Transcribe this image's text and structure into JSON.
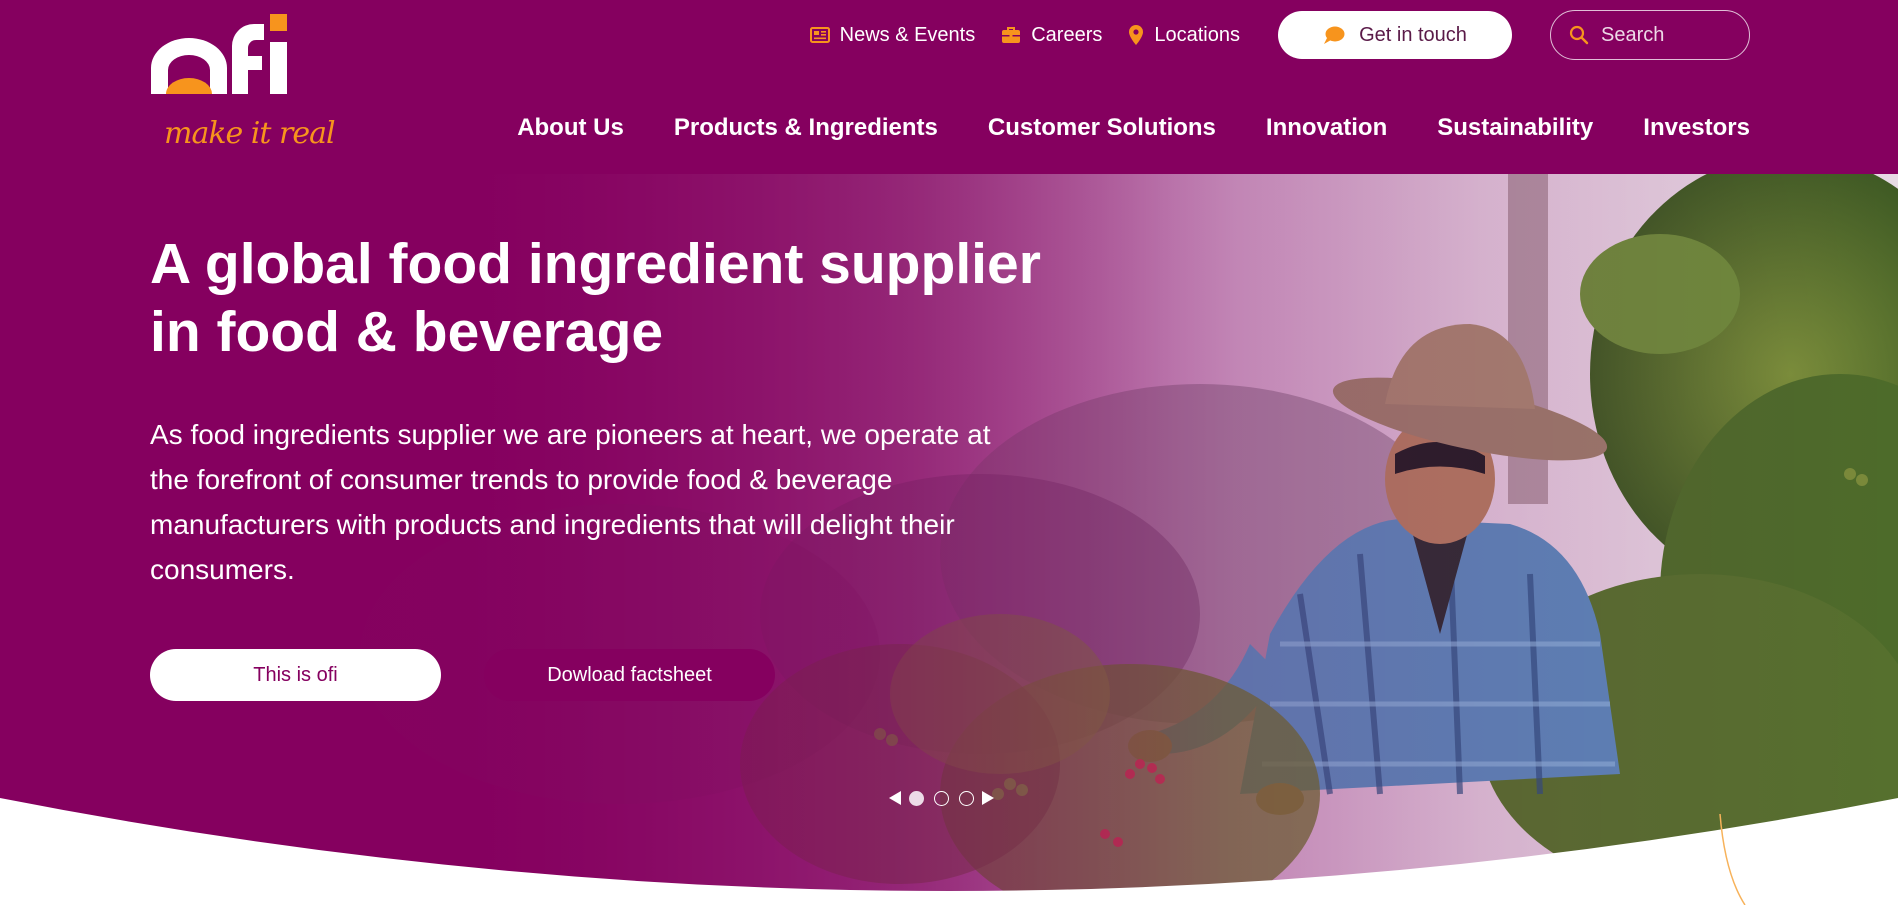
{
  "brand": {
    "logo_text": "ofi",
    "tagline": "make it real",
    "primary_color": "#85005f",
    "accent_color": "#f7941d"
  },
  "utility_nav": {
    "news": {
      "label": "News & Events",
      "icon": "newspaper-icon"
    },
    "careers": {
      "label": "Careers",
      "icon": "briefcase-icon"
    },
    "locations": {
      "label": "Locations",
      "icon": "map-pin-icon"
    },
    "contact": {
      "label": "Get in touch",
      "icon": "chat-bubble-icon"
    },
    "search": {
      "placeholder": "Search",
      "icon": "search-icon"
    }
  },
  "main_nav": [
    "About Us",
    "Products & Ingredients",
    "Customer Solutions",
    "Innovation",
    "Sustainability",
    "Investors"
  ],
  "hero": {
    "title": "A global food ingredient supplier in food & beverage",
    "text": "As food ingredients supplier we are pioneers at heart, we operate at the forefront of consumer trends to provide food & beverage manufacturers with products and ingredients that will delight their consumers.",
    "primary_button": "This is ofi",
    "secondary_button": "Dowload factsheet",
    "slide_count": 3,
    "active_slide": 1
  }
}
